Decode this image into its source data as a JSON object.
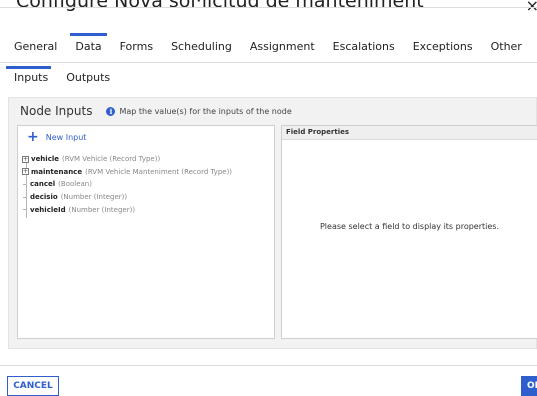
{
  "dialog": {
    "title": "Configure Nova sol·licitud de manteniment",
    "close_glyph": "×"
  },
  "tabs": [
    "General",
    "Data",
    "Forms",
    "Scheduling",
    "Assignment",
    "Escalations",
    "Exceptions",
    "Other"
  ],
  "active_tab": "Data",
  "subtabs": [
    "Inputs",
    "Outputs"
  ],
  "active_subtab": "Inputs",
  "node_inputs": {
    "title": "Node Inputs",
    "info_icon": "info-icon",
    "description": "Map the value(s) for the inputs of the node",
    "new_input_label": "New Input",
    "items": [
      {
        "name": "vehicle",
        "type": "(RVM Vehicle (Record Type))",
        "expandable": true
      },
      {
        "name": "maintenance",
        "type": "(RVM Vehicle Manteniment (Record Type))",
        "expandable": true
      },
      {
        "name": "cancel",
        "type": "(Boolean)",
        "expandable": false
      },
      {
        "name": "decisio",
        "type": "(Number (Integer))",
        "expandable": false
      },
      {
        "name": "vehicleId",
        "type": "(Number (Integer))",
        "expandable": false
      }
    ]
  },
  "field_properties": {
    "title": "Field Properties",
    "empty_message": "Please select a field to display its properties."
  },
  "footer": {
    "cancel_label": "CANCEL",
    "ok_label": "OK"
  },
  "colors": {
    "accent": "#2f5fcc"
  }
}
